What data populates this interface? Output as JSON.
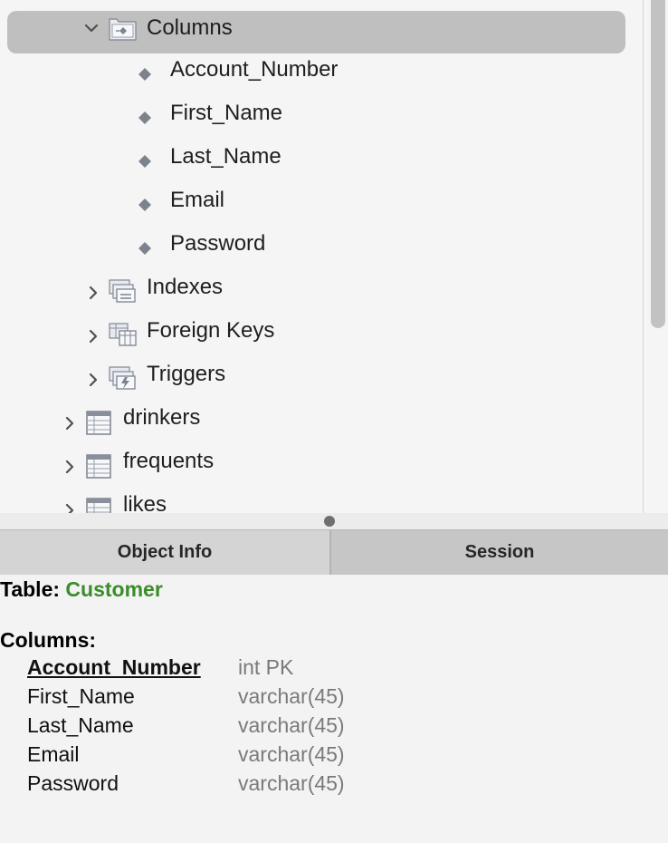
{
  "tree": {
    "columns_folder": "Columns",
    "columns": [
      "Account_Number",
      "First_Name",
      "Last_Name",
      "Email",
      "Password"
    ],
    "indexes_folder": "Indexes",
    "foreign_keys_folder": "Foreign Keys",
    "triggers_folder": "Triggers",
    "tables": [
      "drinkers",
      "frequents",
      "likes"
    ]
  },
  "tabs": {
    "object_info": "Object Info",
    "session": "Session"
  },
  "info": {
    "table_label": "Table:",
    "table_name": "Customer",
    "columns_label": "Columns:",
    "columns": [
      {
        "name": "Account_Number",
        "type": "int PK"
      },
      {
        "name": "First_Name",
        "type": "varchar(45)"
      },
      {
        "name": "Last_Name",
        "type": "varchar(45)"
      },
      {
        "name": "Email",
        "type": "varchar(45)"
      },
      {
        "name": "Password",
        "type": "varchar(45)"
      }
    ]
  },
  "colors": {
    "table_name": "#3b8c2a",
    "selection": "#bfbfbf"
  }
}
